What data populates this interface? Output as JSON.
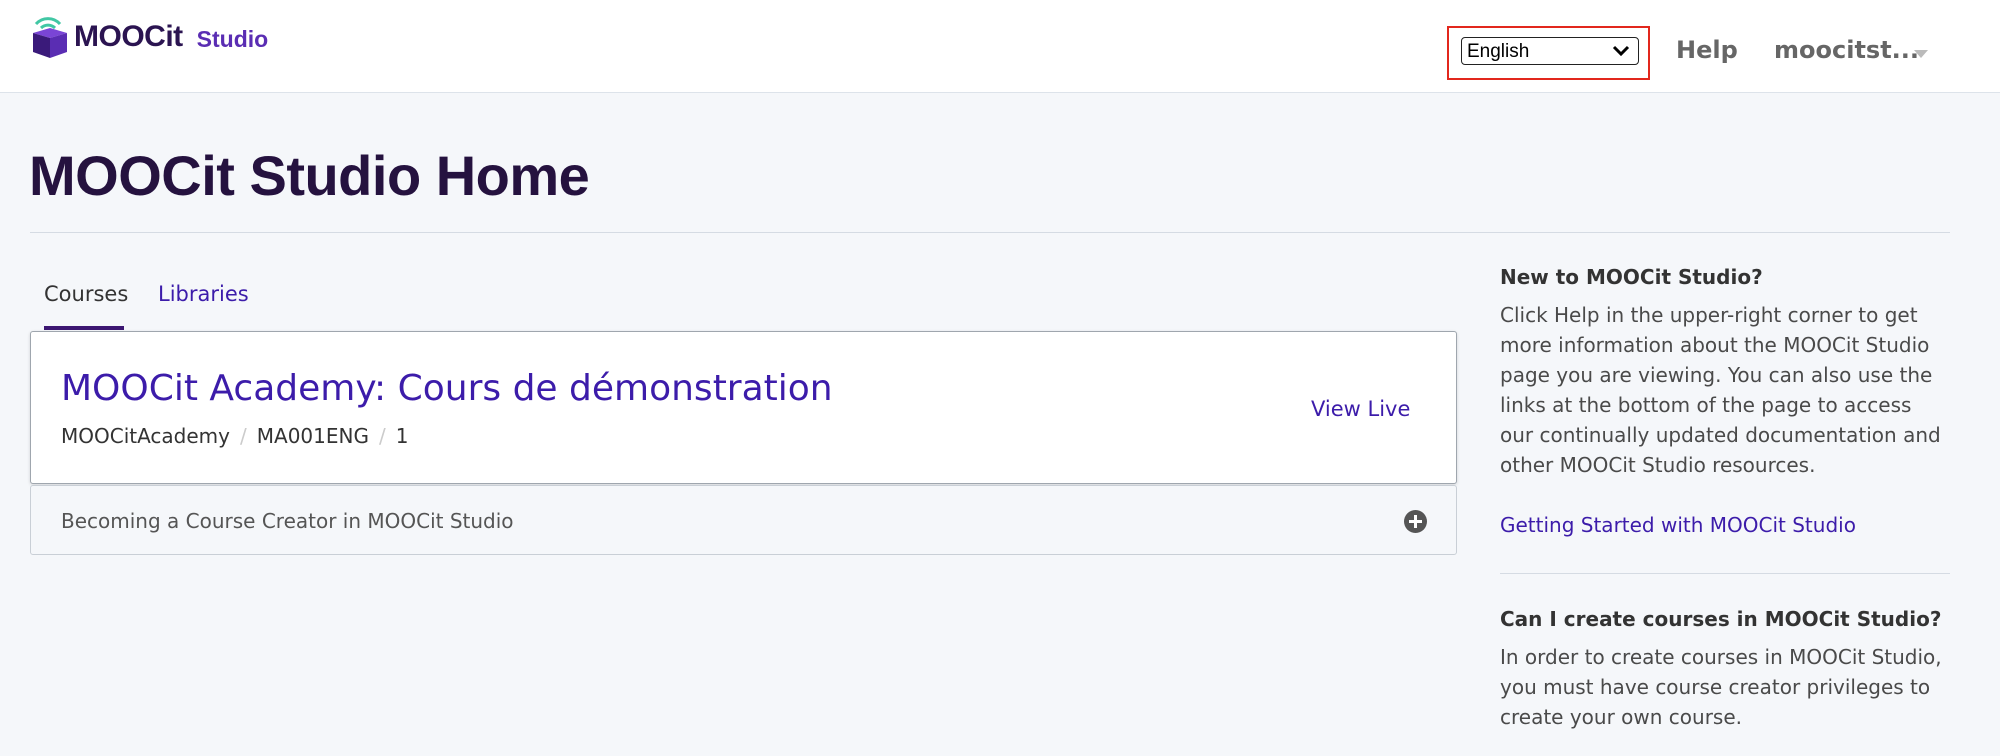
{
  "header": {
    "logo_text": "MOOCit",
    "logo_suffix": "Studio",
    "language_selected": "English",
    "help_label": "Help",
    "user_label": "moocitst..."
  },
  "page": {
    "title": "MOOCit Studio Home"
  },
  "tabs": [
    {
      "label": "Courses",
      "active": true
    },
    {
      "label": "Libraries",
      "active": false
    }
  ],
  "course": {
    "title": "MOOCit Academy: Cours de démonstration",
    "org": "MOOCitAcademy",
    "number": "MA001ENG",
    "run": "1",
    "view_live_label": "View Live"
  },
  "accordion": {
    "label": "Becoming a Course Creator in MOOCit Studio"
  },
  "sidebar": {
    "new_heading": "New to MOOCit Studio?",
    "new_text": "Click Help in the upper-right corner to get more information about the MOOCit Studio page you are viewing. You can also use the links at the bottom of the page to access our continually updated documentation and other MOOCit Studio resources.",
    "getting_started_link": "Getting Started with MOOCit Studio",
    "create_heading": "Can I create courses in MOOCit Studio?",
    "create_text": "In order to create courses in MOOCit Studio, you must have course creator privileges to create your own course."
  },
  "colors": {
    "brand": "#2b1451",
    "link": "#3c1caa",
    "highlight_box": "#e2271d"
  }
}
